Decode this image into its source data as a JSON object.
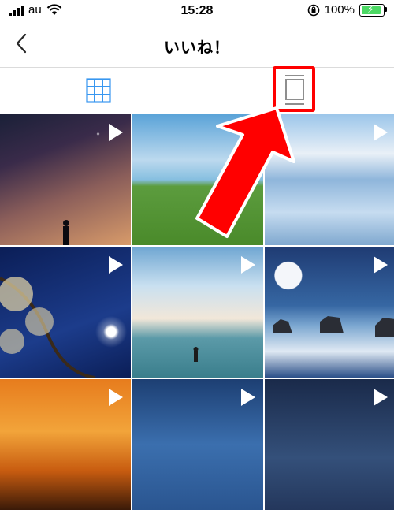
{
  "status_bar": {
    "carrier": "au",
    "time": "15:28",
    "battery_percent": "100%",
    "icons": [
      "signal-icon",
      "wifi-icon",
      "rotation-lock-icon",
      "battery-charging-icon"
    ]
  },
  "navbar": {
    "title": "いいね！",
    "back_icon": "chevron-left-icon"
  },
  "tabs": [
    {
      "name": "grid-view",
      "icon": "grid-icon",
      "selected": true,
      "color": "#3897f0"
    },
    {
      "name": "feed-view",
      "icon": "single-post-icon",
      "selected": false,
      "color": "#8e8e8e"
    }
  ],
  "annotation": {
    "highlight_color": "#ff0000",
    "arrow_color": "#ff0000"
  },
  "grid": {
    "items": [
      {
        "type": "video",
        "icon": "play-icon"
      },
      {
        "type": "video",
        "icon": "play-icon"
      },
      {
        "type": "video",
        "icon": "play-icon"
      },
      {
        "type": "video",
        "icon": "play-icon"
      },
      {
        "type": "video",
        "icon": "play-icon"
      },
      {
        "type": "video",
        "icon": "play-icon"
      },
      {
        "type": "video",
        "icon": "play-icon"
      },
      {
        "type": "video",
        "icon": "play-icon"
      },
      {
        "type": "video",
        "icon": "play-icon"
      }
    ]
  }
}
